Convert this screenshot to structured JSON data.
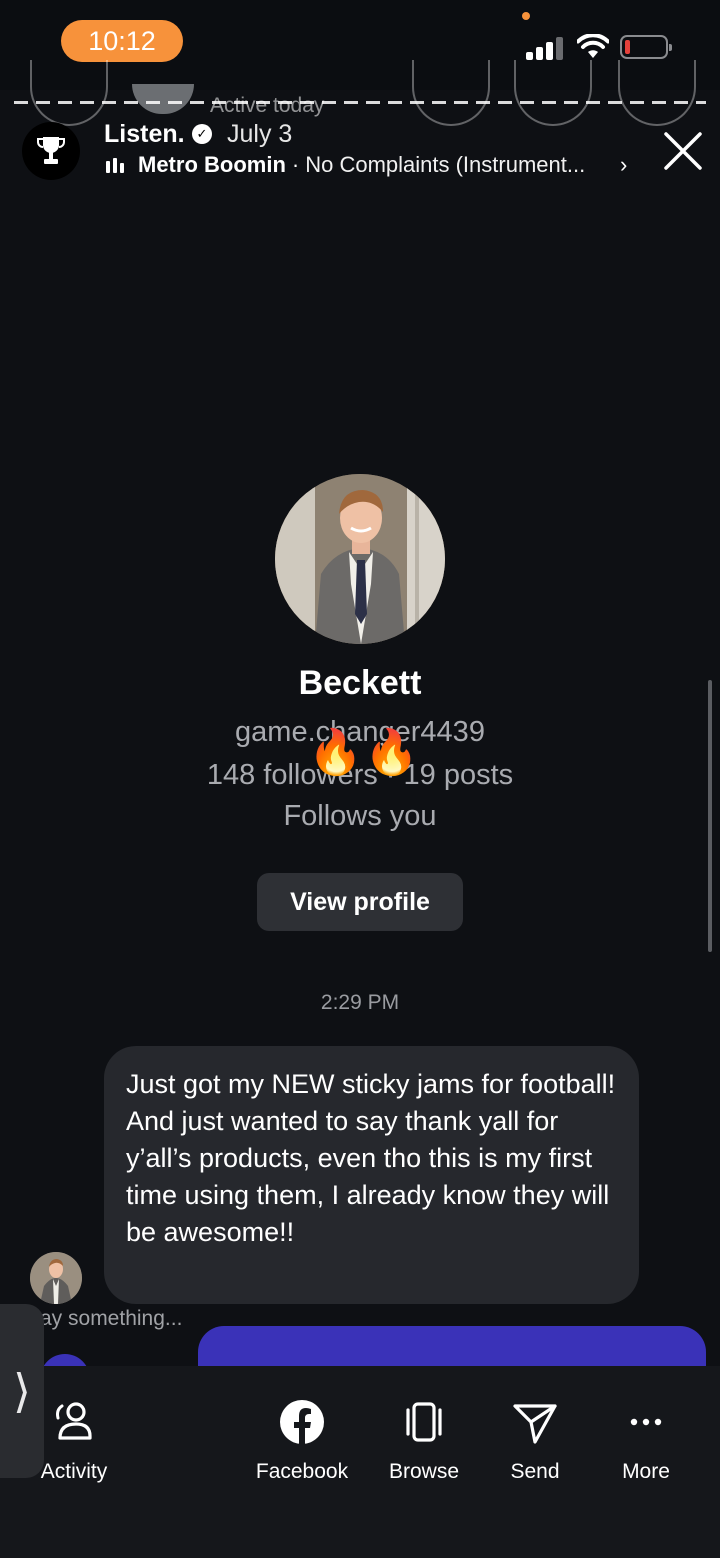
{
  "status_bar": {
    "time": "10:12",
    "signal_icon": "cellular-signal-icon",
    "wifi_icon": "wifi-icon",
    "battery_icon": "battery-low-icon",
    "accent_color": "#f7923b"
  },
  "background_header": {
    "active_status": "Active today"
  },
  "story": {
    "account_name": "Listen.",
    "date": "July 3",
    "verified_icon": "verified-badge-icon",
    "avatar_icon": "trophy-icon",
    "music_artist": "Metro Boomin",
    "music_separator": "·",
    "music_title": "No Complaints (Instrument...",
    "music_chevron": "›",
    "close_icon": "close-icon"
  },
  "profile": {
    "name": "Beckett",
    "username": "game.changer4439",
    "stats": "148 followers · 19 posts",
    "follows_you": "Follows you",
    "view_profile_label": "View profile",
    "stickers": [
      "🔥",
      "🔥"
    ]
  },
  "chat": {
    "timestamp": "2:29 PM",
    "message": "Just got my NEW sticky jams for football! And just wanted to say thank yall for y’all’s products, even tho this is my first time using them, I already know they will be awesome!!",
    "composer_placeholder": "ay something..."
  },
  "share_sheet": {
    "handle_glyph": "⟩",
    "actions": [
      {
        "label": "Activity",
        "icon": "activity-people-icon"
      },
      {
        "label": "Facebook",
        "icon": "facebook-icon"
      },
      {
        "label": "Browse",
        "icon": "browse-cards-icon"
      },
      {
        "label": "Send",
        "icon": "send-paper-plane-icon"
      },
      {
        "label": "More",
        "icon": "more-dots-icon"
      }
    ]
  }
}
